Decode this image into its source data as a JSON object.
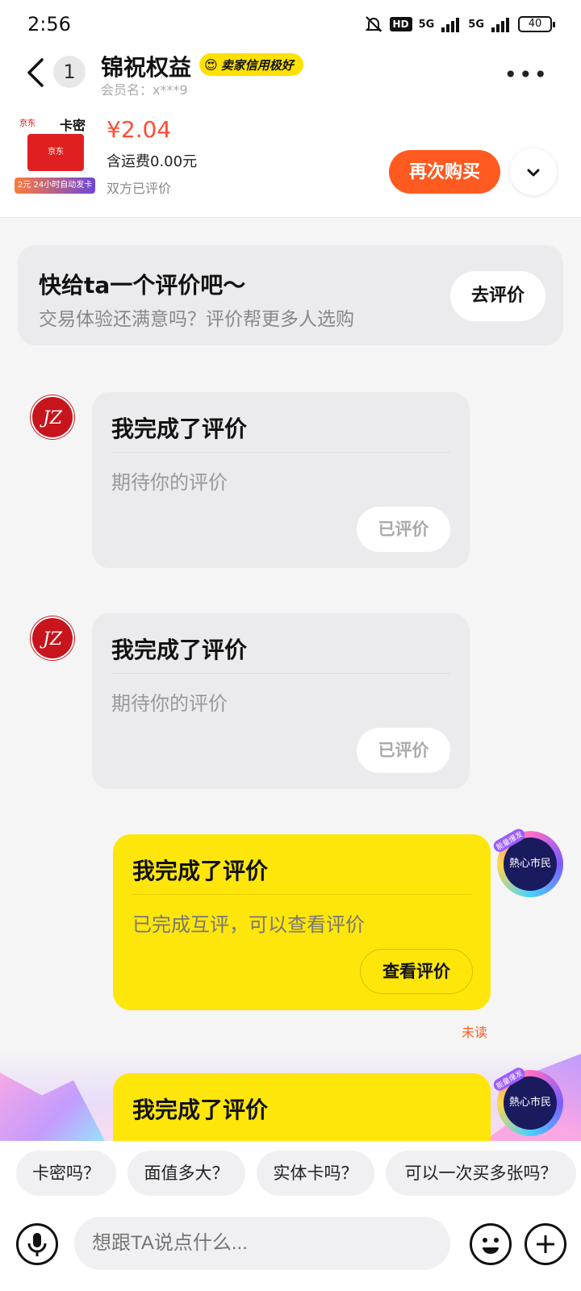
{
  "status_bar": {
    "time": "2:56",
    "hd_label": "HD",
    "network_1": "5G",
    "network_2": "5G",
    "battery": "40"
  },
  "header": {
    "unread_count": "1",
    "shop_name": "锦祝权益",
    "credit_badge": "卖家信用极好",
    "member_name": "会员名：x***9"
  },
  "product": {
    "image_top_label": "卡密",
    "image_brand": "京东",
    "image_strip": "2元 24小时自动发卡",
    "price": "¥2.04",
    "shipping": "含运费0.00元",
    "rating_status": "双方已评价",
    "rebuy_label": "再次购买"
  },
  "review_prompt": {
    "title": "快给ta一个评价吧～",
    "subtitle": "交易体验还满意吗？评价帮更多人选购",
    "button": "去评价"
  },
  "messages": [
    {
      "side": "left",
      "avatar_text": "JZ",
      "title": "我完成了评价",
      "body": "期待你的评价",
      "button": "已评价"
    },
    {
      "side": "left",
      "avatar_text": "JZ",
      "title": "我完成了评价",
      "body": "期待你的评价",
      "button": "已评价"
    },
    {
      "side": "right",
      "avatar_text": "熱心市民",
      "avatar_tag": "能量爆发",
      "title": "我完成了评价",
      "body": "已完成互评，可以查看评价",
      "button": "查看评价",
      "status": "未读"
    },
    {
      "side": "right",
      "avatar_text": "熱心市民",
      "avatar_tag": "能量爆发",
      "title": "我完成了评价"
    }
  ],
  "quick_replies": [
    "卡密吗？",
    "面值多大？",
    "实体卡吗？",
    "可以一次买多张吗？"
  ],
  "input": {
    "placeholder": "想跟TA说点什么..."
  },
  "colors": {
    "accent_orange": "#ff5a1f",
    "price_red": "#ff4b33",
    "bubble_yellow": "#ffe60a",
    "bubble_gray": "#ebebed"
  }
}
